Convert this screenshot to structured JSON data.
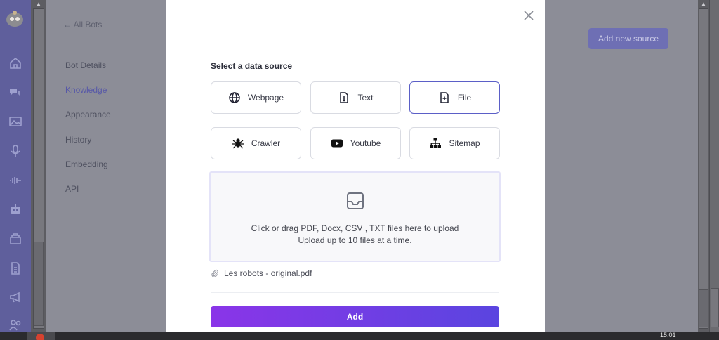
{
  "background": {
    "back_link": "← All Bots",
    "nav": [
      "Bot Details",
      "Knowledge",
      "Appearance",
      "History",
      "Embedding",
      "API"
    ],
    "active_nav": "Knowledge",
    "add_source_button": "Add new source"
  },
  "sidebar_icons": [
    "home-icon",
    "chat-icon",
    "image-icon",
    "microphone-icon",
    "audio-wave-icon",
    "robot-icon",
    "archive-icon",
    "document-icon",
    "megaphone-icon",
    "users-icon"
  ],
  "modal": {
    "section_label": "Select a data source",
    "sources": [
      {
        "label": "Webpage",
        "icon": "globe-icon",
        "selected": false
      },
      {
        "label": "Text",
        "icon": "file-text-icon",
        "selected": false
      },
      {
        "label": "File",
        "icon": "file-plus-icon",
        "selected": true
      },
      {
        "label": "Crawler",
        "icon": "spider-icon",
        "selected": false
      },
      {
        "label": "Youtube",
        "icon": "youtube-icon",
        "selected": false
      },
      {
        "label": "Sitemap",
        "icon": "sitemap-icon",
        "selected": false
      }
    ],
    "dropzone": {
      "line1": "Click or drag PDF, Docx, CSV , TXT files here to upload",
      "line2": "Upload up to 10 files at a time."
    },
    "file_name": "Les robots - original.pdf",
    "add_button": "Add"
  },
  "taskbar": {
    "clock": "15:01"
  },
  "colors": {
    "accent": "#5b5fc7",
    "add_gradient_start": "#8a35e8",
    "add_gradient_end": "#5a45e0",
    "sidebar": "#5f5f9c"
  }
}
